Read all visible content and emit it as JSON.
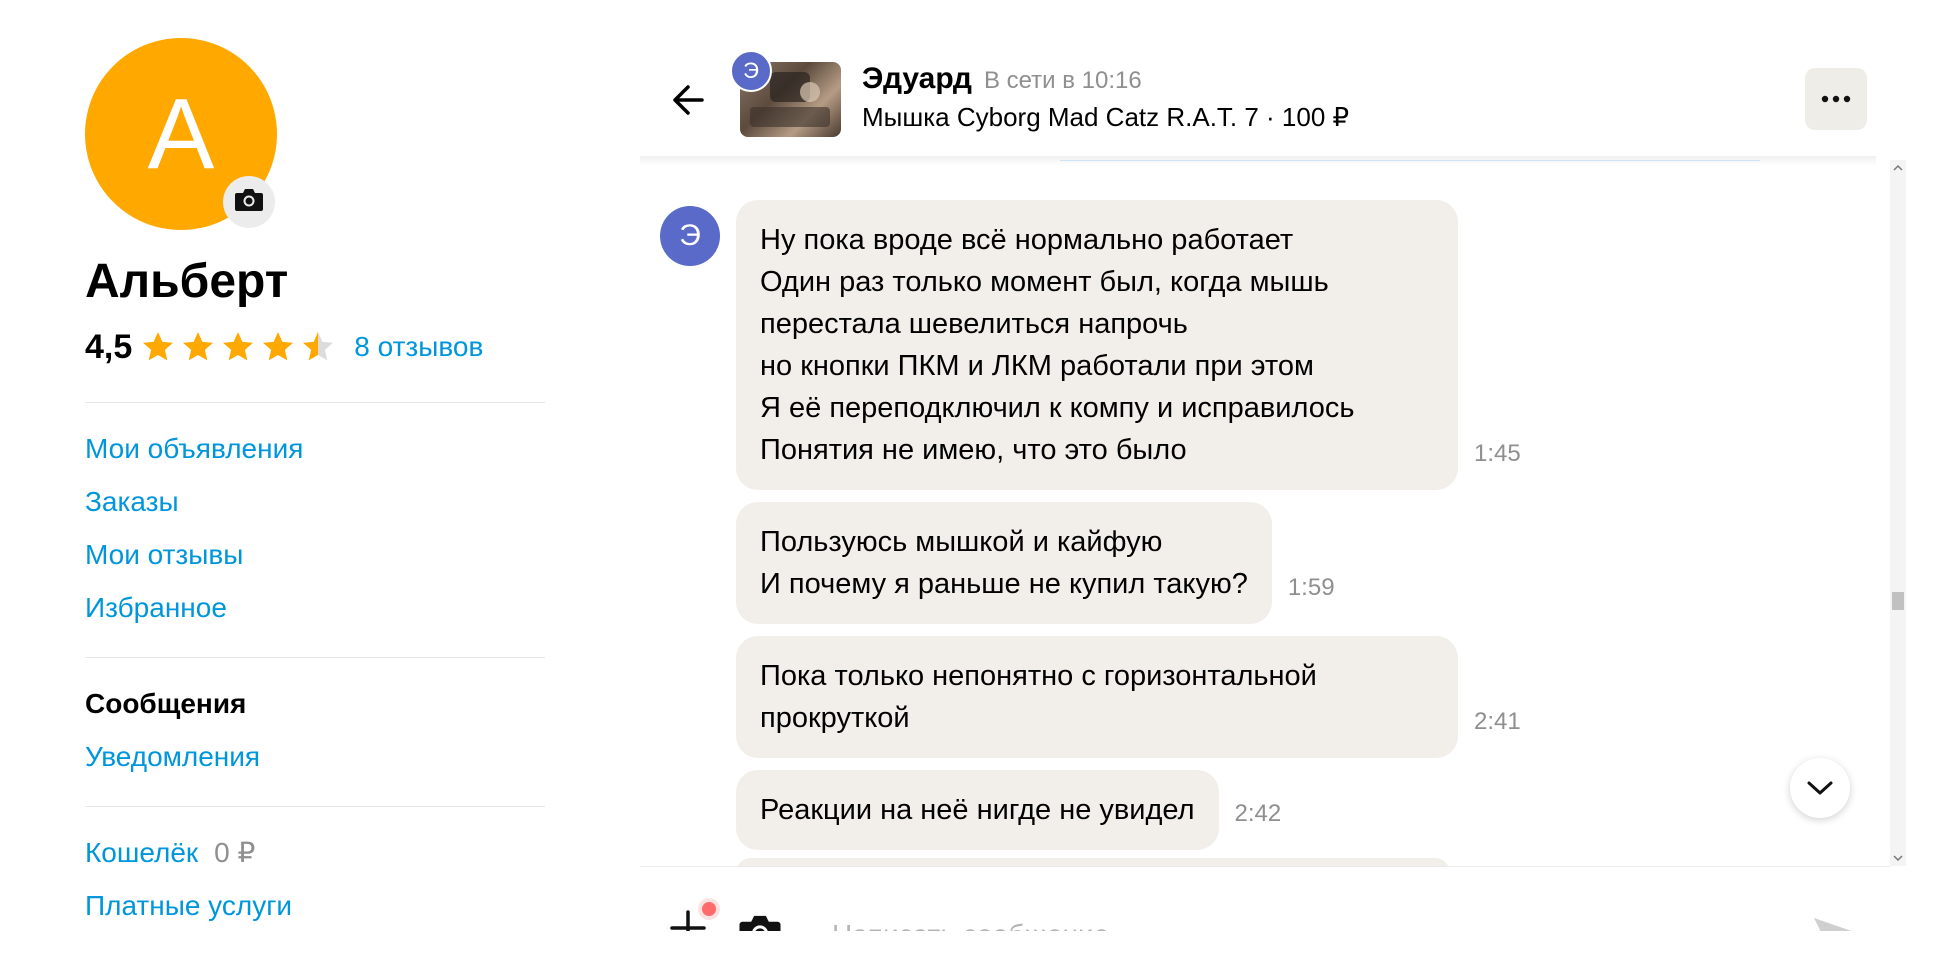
{
  "profile": {
    "avatar_letter": "А",
    "name": "Альберт",
    "rating": "4,5",
    "stars": 4.5,
    "reviews_link": "8 отзывов"
  },
  "nav": {
    "group1": [
      "Мои объявления",
      "Заказы",
      "Мои отзывы",
      "Избранное"
    ],
    "messages_active": "Сообщения",
    "notifications": "Уведомления",
    "wallet_label": "Кошелёк",
    "wallet_amount": "0 ₽",
    "paid_services": "Платные услуги"
  },
  "chat": {
    "contact_initial": "Э",
    "contact_name": "Эдуард",
    "contact_status": "В сети в 10:16",
    "item_title": "Мышка Cyborg Mad Catz R.A.T. 7 · 100 ₽",
    "messages": [
      {
        "text": "Ну пока вроде всё нормально работает\nОдин раз только момент был, когда мышь\nперестала шевелиться напрочь\nно кнопки  ПКМ и ЛКМ работали при этом\nЯ её переподключил к компу и исправилось\nПонятия не имею, что это было",
        "time": "1:45"
      },
      {
        "text": "Пользуюсь мышкой и кайфую\nИ почему я раньше не купил такую?",
        "time": "1:59"
      },
      {
        "text": "Пока только непонятно с горизонтальной\nпрокруткой",
        "time": "2:41"
      },
      {
        "text": "Реакции на неё нигде не увидел",
        "time": "2:42"
      }
    ]
  },
  "composer": {
    "placeholder": "Написать сообщение"
  },
  "colors": {
    "accent_link": "#0096db",
    "avatar_bg": "#ffa800",
    "contact_avatar_bg": "#5a6ac9",
    "bubble_bg": "#f2efea",
    "star": "#ffa800"
  },
  "icons": [
    "camera-icon",
    "star-icon",
    "back-arrow-icon",
    "more-dots-icon",
    "chevron-down-icon",
    "plus-icon",
    "send-icon"
  ]
}
